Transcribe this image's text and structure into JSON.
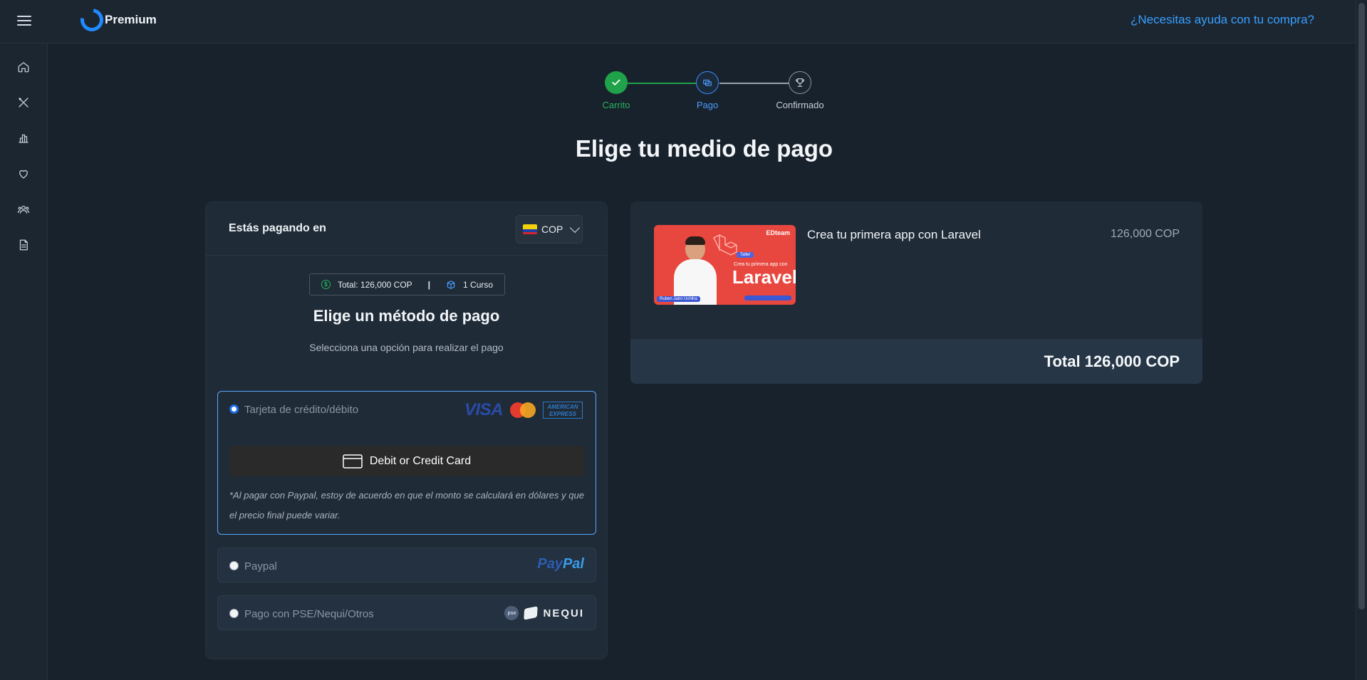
{
  "header": {
    "brand": "Premium",
    "help_link": "¿Necesitas ayuda con tu compra?"
  },
  "sidebar": {
    "items": [
      {
        "icon": "home-icon"
      },
      {
        "icon": "tools-icon"
      },
      {
        "icon": "stats-icon"
      },
      {
        "icon": "heart-icon"
      },
      {
        "icon": "community-icon"
      },
      {
        "icon": "document-icon"
      }
    ]
  },
  "stepper": {
    "steps": [
      {
        "label": "Carrito",
        "state": "done"
      },
      {
        "label": "Pago",
        "state": "current"
      },
      {
        "label": "Confirmado",
        "state": "pending"
      }
    ]
  },
  "page": {
    "title": "Elige tu medio de pago"
  },
  "payment": {
    "paying_in_label": "Estás pagando en",
    "currency": "COP",
    "summary_total": "Total: 126,000 COP",
    "summary_separator": "|",
    "summary_items": "1 Curso",
    "method_title": "Elige un método de pago",
    "method_subtitle": "Selecciona una opción para realizar el pago",
    "options": [
      {
        "label": "Tarjeta de crédito/débito",
        "selected": true
      },
      {
        "label": "Paypal",
        "selected": false
      },
      {
        "label": "Pago con PSE/Nequi/Otros",
        "selected": false
      }
    ],
    "card_logos": {
      "visa": "VISA",
      "amex_line1": "AMERICAN",
      "amex_line2": "EXPRESS"
    },
    "card_button": "Debit or Credit Card",
    "paypal_note": "*Al pagar con Paypal, estoy de acuerdo en que el monto se calculará en dólares y que el precio final puede variar.",
    "paypal_logo_a": "Pay",
    "paypal_logo_b": "Pal",
    "pse_badge": "pse",
    "nequi_logo": "NEQUI"
  },
  "cart": {
    "item": {
      "name": "Crea tu primera app con Laravel",
      "price": "126,000 COP",
      "thumb": {
        "brand": "EDteam",
        "tag": "Taller",
        "subtitle": "Crea tu primera app con",
        "title": "Laravel",
        "instructor": "Ruben Jairo Uchiha"
      }
    },
    "total": "Total 126,000 COP"
  },
  "colors": {
    "accent": "#3aa0ff",
    "success": "#1fa24a",
    "background": "#18222c"
  }
}
